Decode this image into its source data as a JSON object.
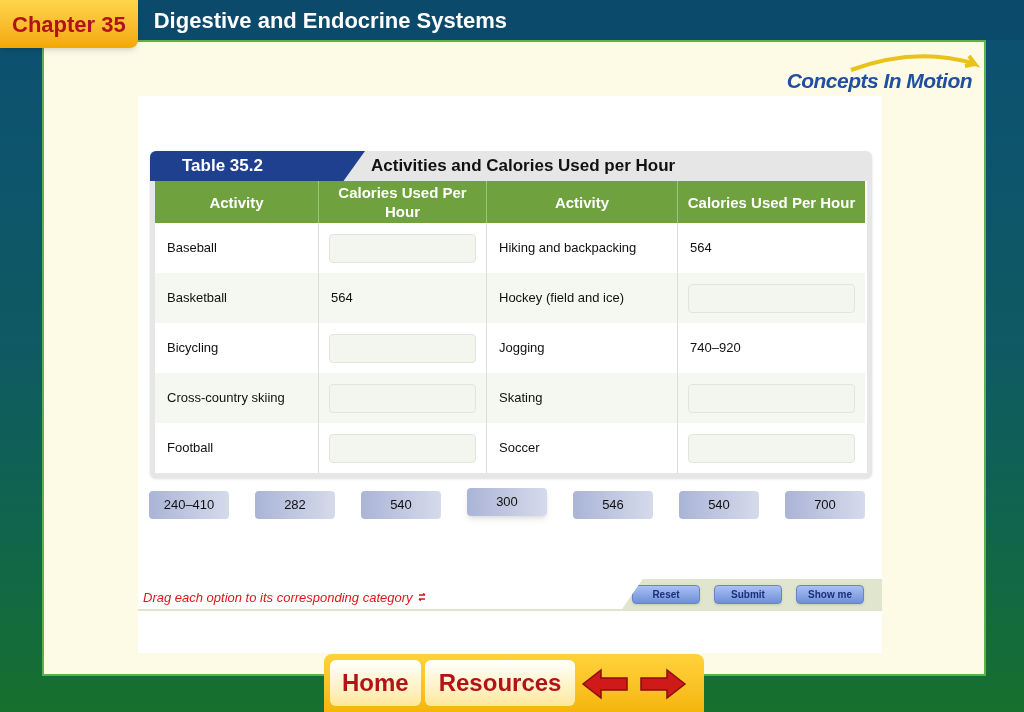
{
  "header": {
    "chapter": "Chapter 35",
    "title": "Digestive and Endocrine Systems"
  },
  "logo": {
    "text": "Concepts In Motion"
  },
  "table": {
    "label": "Table 35.2",
    "title": "Activities and Calories Used per Hour",
    "columns": [
      "Activity",
      "Calories Used Per Hour",
      "Activity",
      "Calories Used Per Hour"
    ],
    "rows": [
      [
        {
          "kind": "text",
          "text": "Baseball"
        },
        {
          "kind": "slot"
        },
        {
          "kind": "text",
          "text": "Hiking and backpacking"
        },
        {
          "kind": "text",
          "text": "564"
        }
      ],
      [
        {
          "kind": "text",
          "text": "Basketball"
        },
        {
          "kind": "text",
          "text": "564"
        },
        {
          "kind": "text",
          "text": "Hockey (field and ice)"
        },
        {
          "kind": "slot"
        }
      ],
      [
        {
          "kind": "text",
          "text": "Bicycling"
        },
        {
          "kind": "slot"
        },
        {
          "kind": "text",
          "text": "Jogging"
        },
        {
          "kind": "text",
          "text": "740–920"
        }
      ],
      [
        {
          "kind": "text",
          "text": "Cross-country skiing"
        },
        {
          "kind": "slot"
        },
        {
          "kind": "text",
          "text": "Skating"
        },
        {
          "kind": "slot"
        }
      ],
      [
        {
          "kind": "text",
          "text": "Football"
        },
        {
          "kind": "slot"
        },
        {
          "kind": "text",
          "text": "Soccer"
        },
        {
          "kind": "slot"
        }
      ]
    ]
  },
  "options": [
    {
      "text": "240–410",
      "lifted": false
    },
    {
      "text": "282",
      "lifted": false
    },
    {
      "text": "540",
      "lifted": false
    },
    {
      "text": "300",
      "lifted": true
    },
    {
      "text": "546",
      "lifted": false
    },
    {
      "text": "540",
      "lifted": false
    },
    {
      "text": "700",
      "lifted": false
    }
  ],
  "instruction": "Drag each option to its corresponding category",
  "buttons": [
    "Reset",
    "Submit",
    "Show me"
  ],
  "nav": {
    "home": "Home",
    "resources": "Resources"
  }
}
